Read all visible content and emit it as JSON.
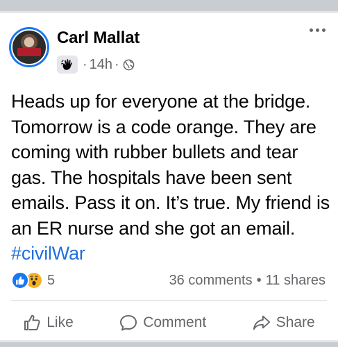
{
  "post": {
    "author": "Carl Mallat",
    "time": "14h",
    "separator": "·",
    "text": "Heads up for everyone at the bridge. Tomorrow is a code orange.  They are coming with rubber bullets and tear gas.  The hospitals have been sent emails. Pass it on. It’s true. My friend is an ER nurse and she got an email.  ",
    "hashtag": "#civilWar"
  },
  "reactions": {
    "count": "5",
    "types": [
      "like",
      "wow"
    ]
  },
  "stats": {
    "comments": "36 comments",
    "dot": "•",
    "shares": "11 shares"
  },
  "actions": {
    "like_label": "Like",
    "comment_label": "Comment",
    "share_label": "Share"
  },
  "icons": {
    "badge": "hand-badge-icon",
    "privacy": "globe-icon",
    "more": "more-horizontal-icon",
    "like": "thumbs-up-icon",
    "comment": "speech-bubble-icon",
    "share": "share-arrow-icon"
  },
  "colors": {
    "link": "#216fdb",
    "brand_blue": "#1877f2",
    "secondary_text": "#65676b",
    "wow_yellow": "#f7b125"
  }
}
